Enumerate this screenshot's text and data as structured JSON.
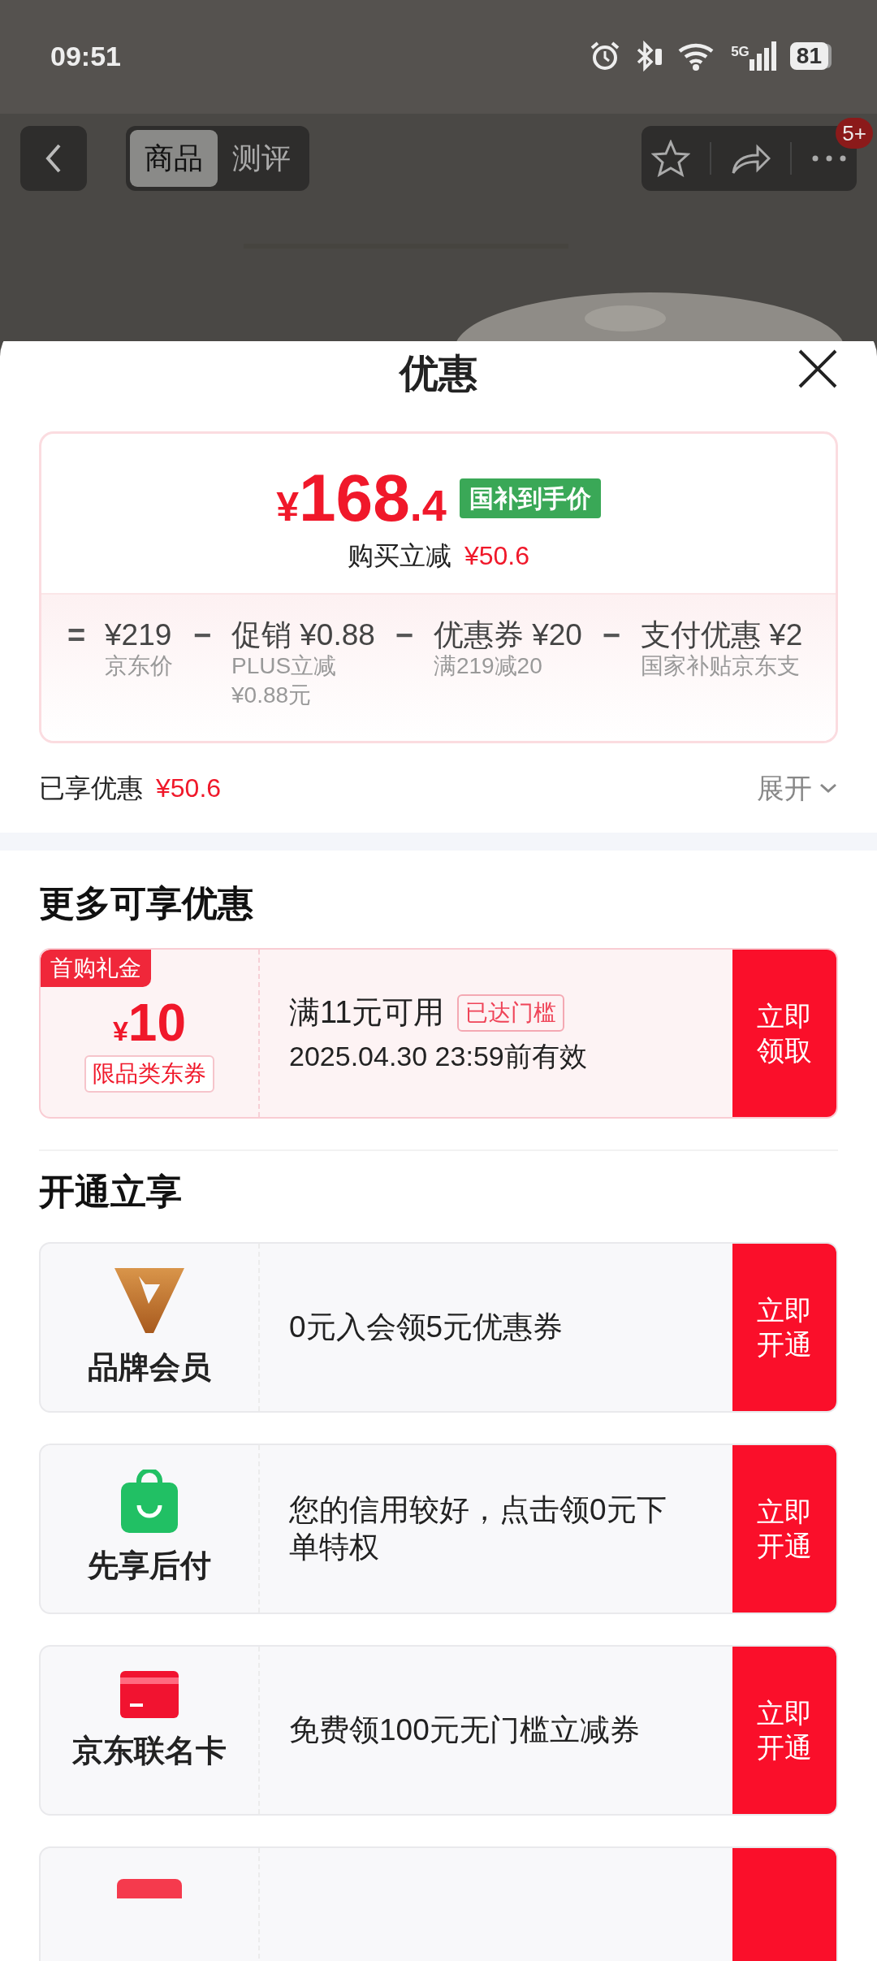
{
  "status_bar": {
    "time": "09:51",
    "network": "5G",
    "battery": "81"
  },
  "nav": {
    "tabs": [
      {
        "label": "商品",
        "selected": true
      },
      {
        "label": "测评",
        "selected": false
      }
    ],
    "badge": "5+"
  },
  "sheet": {
    "title": "优惠",
    "price_card": {
      "currency": "¥",
      "price_main": "168",
      "price_fraction": ".4",
      "price_tag": "国补到手价",
      "saving_label": "购买立减",
      "saving_amount": "¥50.6",
      "breakdown": [
        {
          "operator": "=",
          "amount": "¥219",
          "note": "京东价"
        },
        {
          "operator": "−",
          "amount": "促销 ¥0.88",
          "note": "PLUS立减¥0.88元"
        },
        {
          "operator": "−",
          "amount": "优惠券 ¥20",
          "note": "满219减20"
        },
        {
          "operator": "−",
          "amount": "支付优惠 ¥2",
          "note": "国家补贴京东支"
        }
      ]
    },
    "enjoyed_label": "已享优惠",
    "enjoyed_amount": "¥50.6",
    "expand": "展开"
  },
  "more_offers": {
    "heading": "更多可享优惠",
    "coupons": [
      {
        "tag": "首购礼金",
        "currency": "¥",
        "amount": "10",
        "type": "限品类东券",
        "condition": "满11元可用",
        "status": "已达门槛",
        "validity": "2025.04.30 23:59前有效",
        "button": "立即领取"
      }
    ]
  },
  "open_offers": {
    "heading": "开通立享",
    "items": [
      {
        "kind": "brand",
        "title": "品牌会员",
        "desc": "0元入会领5元优惠券",
        "button": "立即开通"
      },
      {
        "kind": "paylater",
        "title": "先享后付",
        "desc": "您的信用较好，点击领0元下单特权",
        "button": "立即开通"
      },
      {
        "kind": "card",
        "title": "京东联名卡",
        "desc": "免费领100元无门槛立减券",
        "button": "立即开通"
      },
      {
        "kind": "partial"
      }
    ]
  }
}
